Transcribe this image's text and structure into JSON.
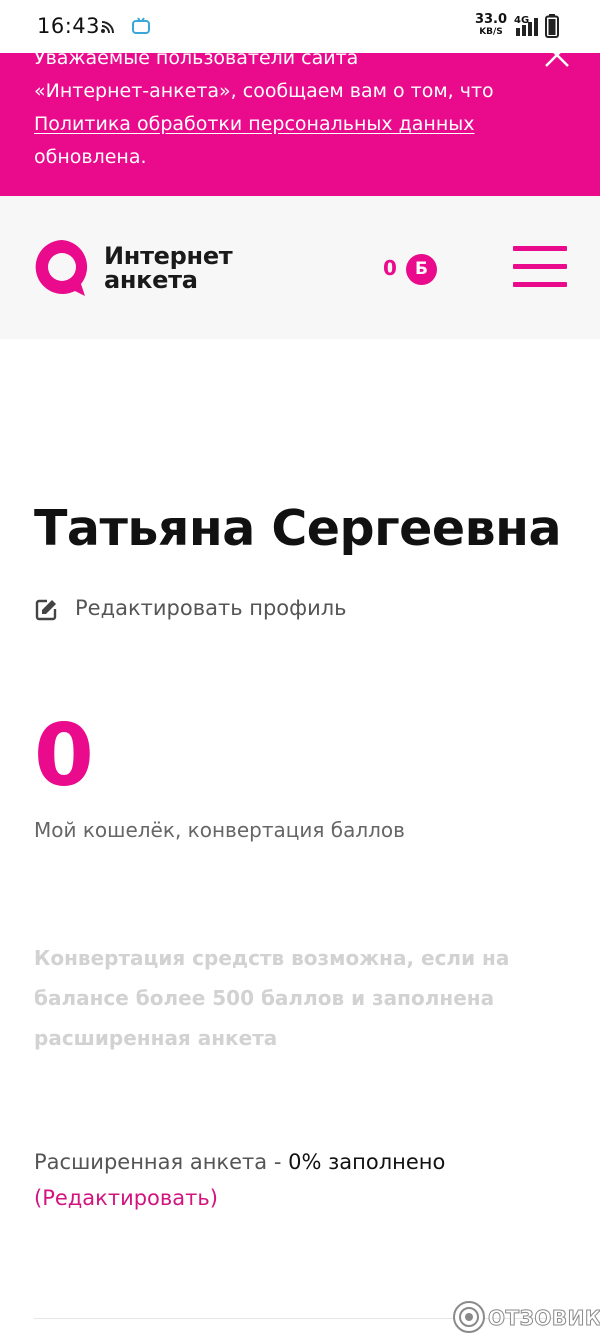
{
  "status_bar": {
    "time": "16:43",
    "net_speed": "33.0",
    "net_speed_unit": "KB/S",
    "network_type": "4G",
    "icons": [
      "cast-icon",
      "app-notification-icon",
      "signal-icon",
      "battery-icon"
    ]
  },
  "banner": {
    "line_top_partial": "Уважаемые пользователи сайта",
    "line_1": "«Интернет-анкета», сообщаем вам о том, что",
    "link_text": "Политика обработки персональных данных",
    "line_3": "обновлена.",
    "background_color": "#ea0a8c",
    "close_icon": "close-icon"
  },
  "header": {
    "logo_line_1": "Интернет",
    "logo_line_2": "анкета",
    "points_value": "0",
    "points_badge": "Б",
    "menu_icon": "hamburger-menu-icon",
    "accent_color": "#ea0a8c"
  },
  "profile": {
    "name": "Татьяна Сергеевна",
    "edit_label": "Редактировать профиль",
    "edit_icon": "edit-icon"
  },
  "wallet": {
    "balance": "0",
    "caption": "Мой кошелёк, конвертация баллов",
    "note_lines": [
      "Конвертация средств возможна, если на",
      "балансе более 500 баллов и заполнена",
      "расширенная анкета"
    ]
  },
  "extended_profile": {
    "label": "Расширенная анкета",
    "dash": "-",
    "status": "0% заполнено",
    "edit_link": "(Редактировать)"
  },
  "watermark": {
    "text": "ОТЗОВИК"
  }
}
